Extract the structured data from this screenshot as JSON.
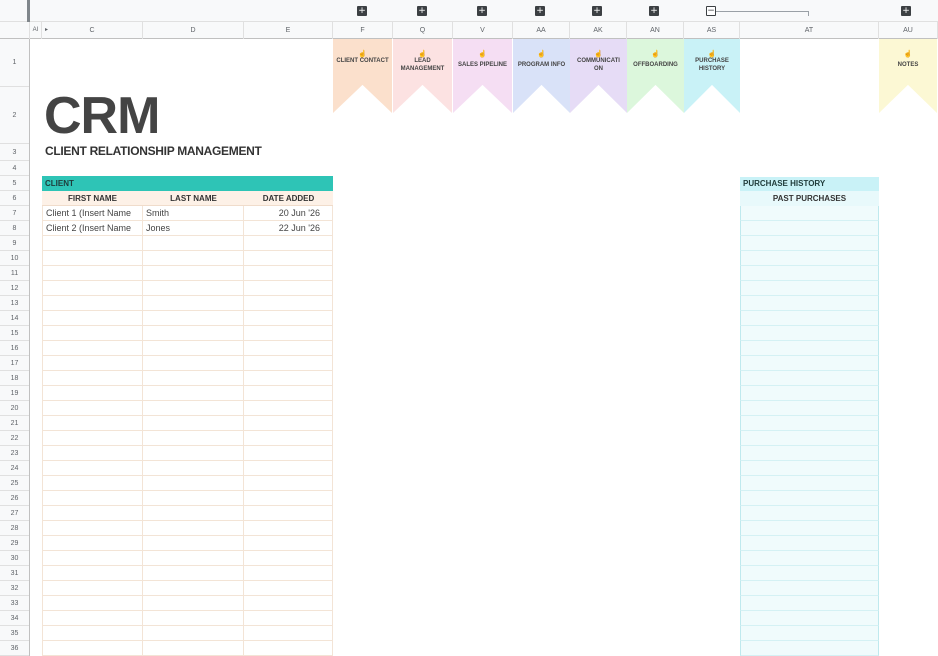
{
  "group_bar": {
    "plus_icons": [
      "+",
      "+",
      "+",
      "+",
      "+",
      "+",
      "+"
    ],
    "minus_icon": "−"
  },
  "columns": {
    "corner_label": "AI",
    "c": "C",
    "d": "D",
    "e": "E",
    "f": "F",
    "q": "Q",
    "v": "V",
    "aa": "AA",
    "ak": "AK",
    "an": "AN",
    "as": "AS",
    "at": "AT",
    "au": "AU"
  },
  "rows": [
    "1",
    "2",
    "3",
    "4",
    "5",
    "6",
    "7",
    "8",
    "9",
    "10",
    "11",
    "12",
    "13",
    "14",
    "15",
    "16",
    "17",
    "18",
    "19",
    "20",
    "21",
    "22",
    "23",
    "24",
    "25",
    "26",
    "27",
    "28",
    "29",
    "30",
    "31",
    "32",
    "33",
    "34",
    "35",
    "36"
  ],
  "banners": [
    {
      "label": "CLIENT CONTACT",
      "color": "#fbe0cc",
      "icon": "pointer-hand-icon"
    },
    {
      "label": "LEAD MANAGEMENT",
      "color": "#fce2e2",
      "icon": "pointer-hand-icon"
    },
    {
      "label": "SALES PIPELINE",
      "color": "#f5def3",
      "icon": "pointer-hand-icon"
    },
    {
      "label": "PROGRAM INFO",
      "color": "#d9e2f8",
      "icon": "pointer-hand-icon"
    },
    {
      "label": "COMMUNICATI ON",
      "color": "#e6dcf6",
      "icon": "pointer-hand-icon"
    },
    {
      "label": "OFFBOARDING",
      "color": "#dcf7dc",
      "icon": "pointer-hand-icon"
    },
    {
      "label": "PURCHASE HISTORY",
      "color": "#c9f2f7",
      "icon": "pointer-hand-icon"
    },
    {
      "label": "NOTES",
      "color": "#fcf8d4",
      "icon": "pointer-hand-icon"
    }
  ],
  "title": "CRM",
  "subtitle": "CLIENT RELATIONSHIP MANAGEMENT",
  "client_section": {
    "header": "CLIENT",
    "header_color": "#2ec4b6",
    "columns": [
      "FIRST NAME",
      "LAST NAME",
      "DATE ADDED"
    ],
    "rows": [
      {
        "first": "Client 1 (Insert Name",
        "last": "Smith",
        "date": "20 Jun '26"
      },
      {
        "first": "Client 2 (Insert Name",
        "last": "Jones",
        "date": "22 Jun '26"
      }
    ]
  },
  "purchase_section": {
    "header": "PURCHASE HISTORY",
    "header_color": "#c9f2f7",
    "column": "PAST PURCHASES"
  }
}
